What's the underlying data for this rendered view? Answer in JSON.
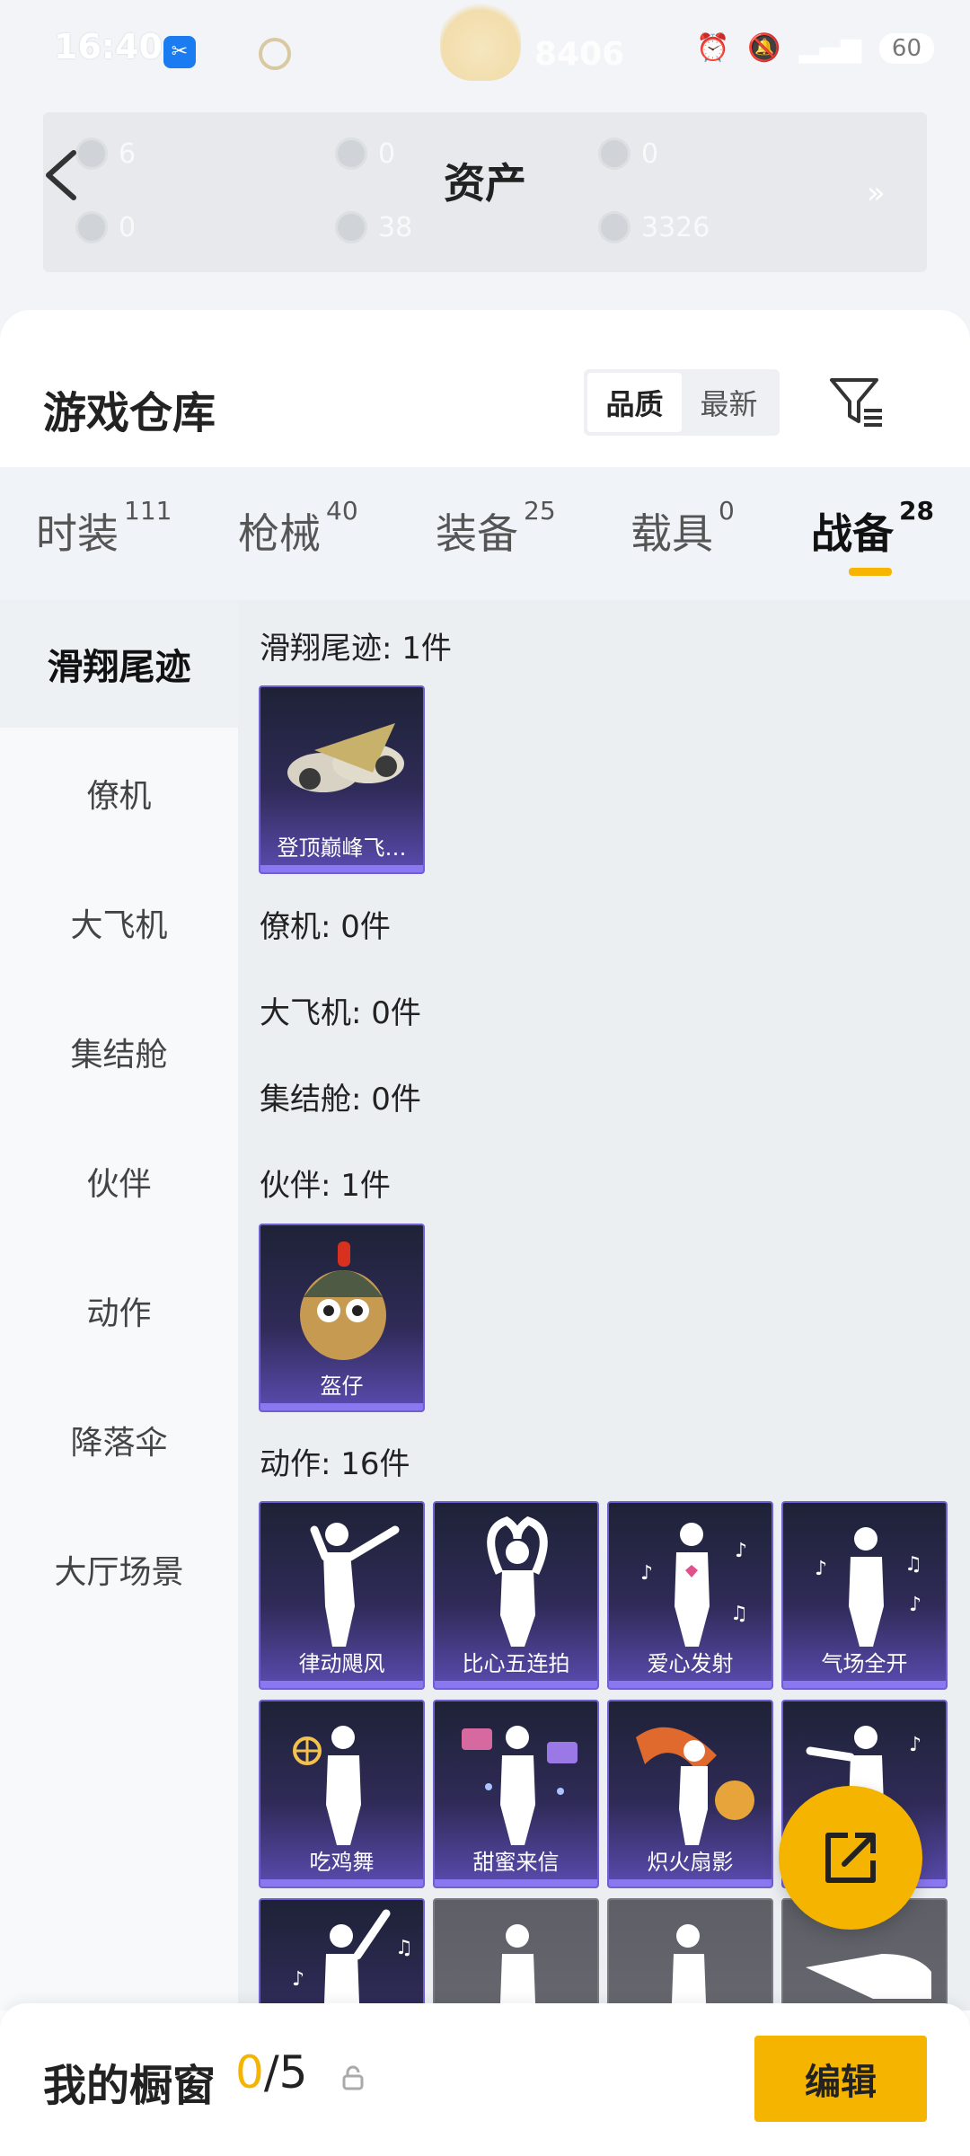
{
  "status_bar": {
    "time": "16:40",
    "score": "8406",
    "battery": "60"
  },
  "assets": {
    "title": "资产",
    "items": [
      "6",
      "0",
      "0",
      "0",
      "38",
      "3326"
    ],
    "more": "»"
  },
  "panel": {
    "title": "游戏仓库",
    "sort": [
      "品质",
      "最新"
    ]
  },
  "tabs": [
    {
      "label": "时装",
      "count": "111"
    },
    {
      "label": "枪械",
      "count": "40"
    },
    {
      "label": "装备",
      "count": "25"
    },
    {
      "label": "载具",
      "count": "0"
    },
    {
      "label": "战备",
      "count": "28"
    }
  ],
  "sidebar": [
    "滑翔尾迹",
    "僚机",
    "大飞机",
    "集结舱",
    "伙伴",
    "动作",
    "降落伞",
    "大厅场景"
  ],
  "sections": {
    "glide": {
      "label": "滑翔尾迹: 1件",
      "items": [
        "登顶巅峰飞…"
      ]
    },
    "wingman": {
      "label": "僚机: 0件"
    },
    "plane": {
      "label": "大飞机: 0件"
    },
    "pod": {
      "label": "集结舱: 0件"
    },
    "partner": {
      "label": "伙伴: 1件",
      "items": [
        "盔仔"
      ]
    },
    "emote": {
      "label": "动作: 16件",
      "items": [
        "律动飓风",
        "比心五连拍",
        "爱心发射",
        "气场全开",
        "吃鸡舞",
        "甜蜜来信",
        "炽火扇影"
      ]
    }
  },
  "bottom": {
    "label": "我的橱窗",
    "current": "0",
    "total": "/5",
    "edit": "编辑"
  }
}
